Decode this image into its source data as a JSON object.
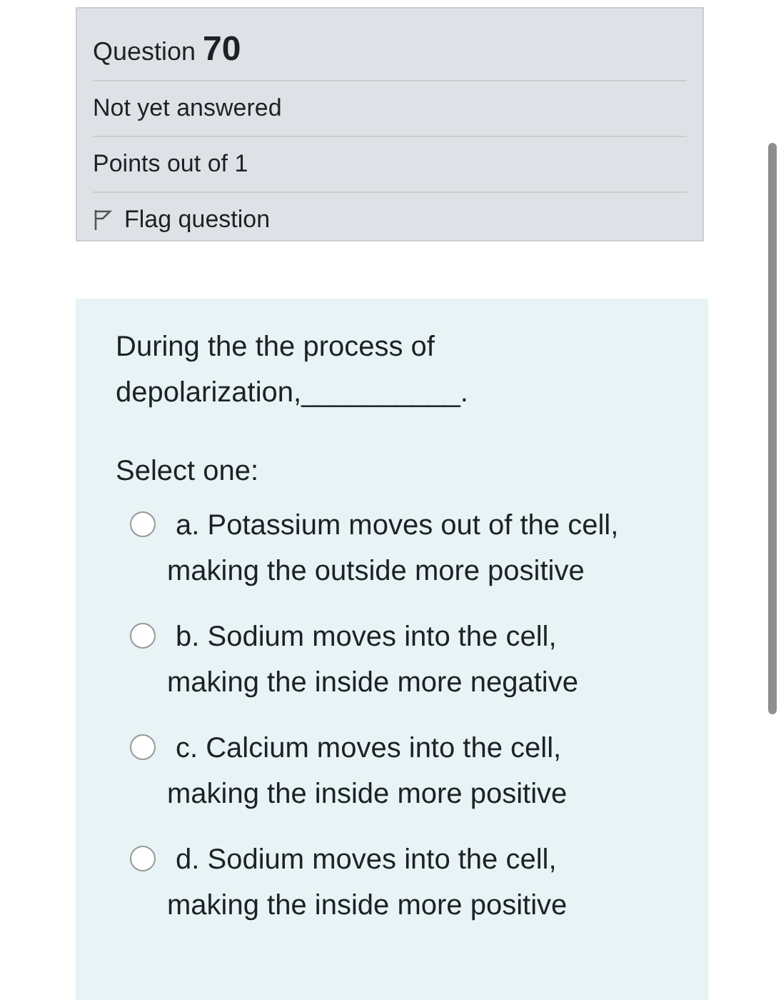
{
  "info": {
    "label": "Question",
    "number": "70",
    "status": "Not yet answered",
    "points": "Points out of 1",
    "flag": {
      "label": "Flag question",
      "flagged": false
    }
  },
  "question": {
    "text": "During the the process of depolarization,__________.",
    "prompt": "Select one:",
    "options": [
      {
        "text": "a. Potassium moves out of the cell, making the outside more positive",
        "selected": false
      },
      {
        "text": "b. Sodium moves into the cell, making the inside more negative",
        "selected": false
      },
      {
        "text": "c. Calcium moves into the cell, making the inside more positive",
        "selected": false
      },
      {
        "text": "d. Sodium moves into the cell, making the inside more positive",
        "selected": false
      }
    ]
  }
}
